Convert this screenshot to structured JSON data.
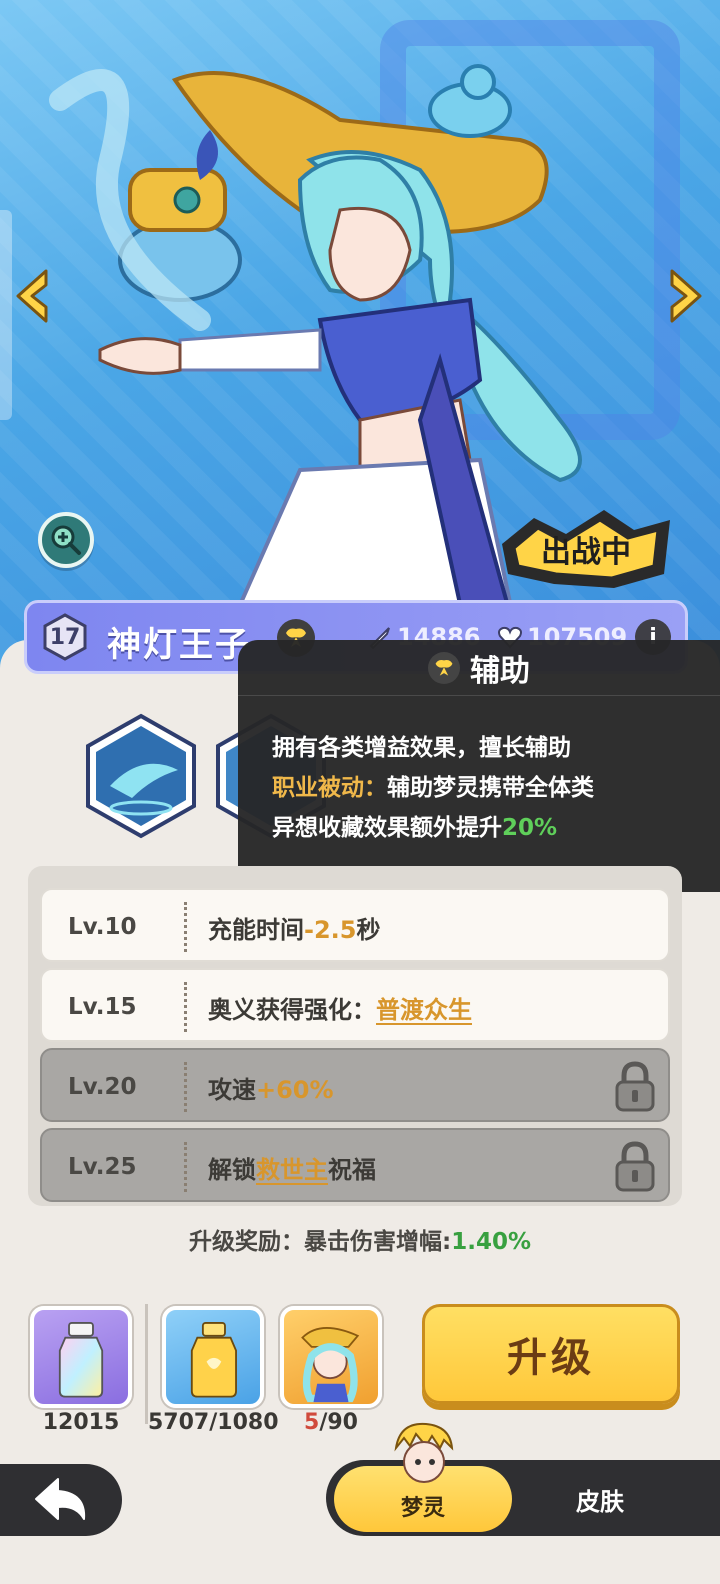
{
  "hero": {
    "name": "神灯王子",
    "level": "17",
    "power": "14886",
    "hp": "107509",
    "info_label": "i",
    "deployed_badge": "出战中"
  },
  "tooltip": {
    "title": "辅助",
    "line1": "拥有各类增益效果，擅长辅助",
    "passive_label": "职业被动：",
    "passive_text_a": "辅助梦灵携带全体类",
    "passive_text_b": "异想收藏效果额外提升",
    "passive_value": "20%"
  },
  "levels": [
    {
      "lv": "Lv.10",
      "text_a": "充能时间",
      "value": "-2.5",
      "text_b": "秒",
      "locked": false
    },
    {
      "lv": "Lv.15",
      "text_a": "奥义获得强化：",
      "link": "普渡众生",
      "locked": false
    },
    {
      "lv": "Lv.20",
      "text_a": "攻速",
      "value": "+60%",
      "locked": true
    },
    {
      "lv": "Lv.25",
      "text_a": "解锁",
      "link": "救世主",
      "text_b": "祝福",
      "locked": true
    }
  ],
  "reward": {
    "label": "升级奖励：暴击伤害增幅:",
    "value": "1.40%"
  },
  "materials": [
    {
      "icon": "rainbow-bottle-icon",
      "count": "12015"
    },
    {
      "icon": "gold-bottle-icon",
      "count": "5707/1080"
    },
    {
      "icon": "hero-shard-icon",
      "count_have": "5",
      "count_need": "/90"
    }
  ],
  "upgrade_button": "升级",
  "tabs": {
    "dream": "梦灵",
    "skin": "皮肤"
  },
  "colors": {
    "accent_gold": "#d8962c",
    "positive_green": "#38a040",
    "header_purple": "#8f95f3"
  }
}
